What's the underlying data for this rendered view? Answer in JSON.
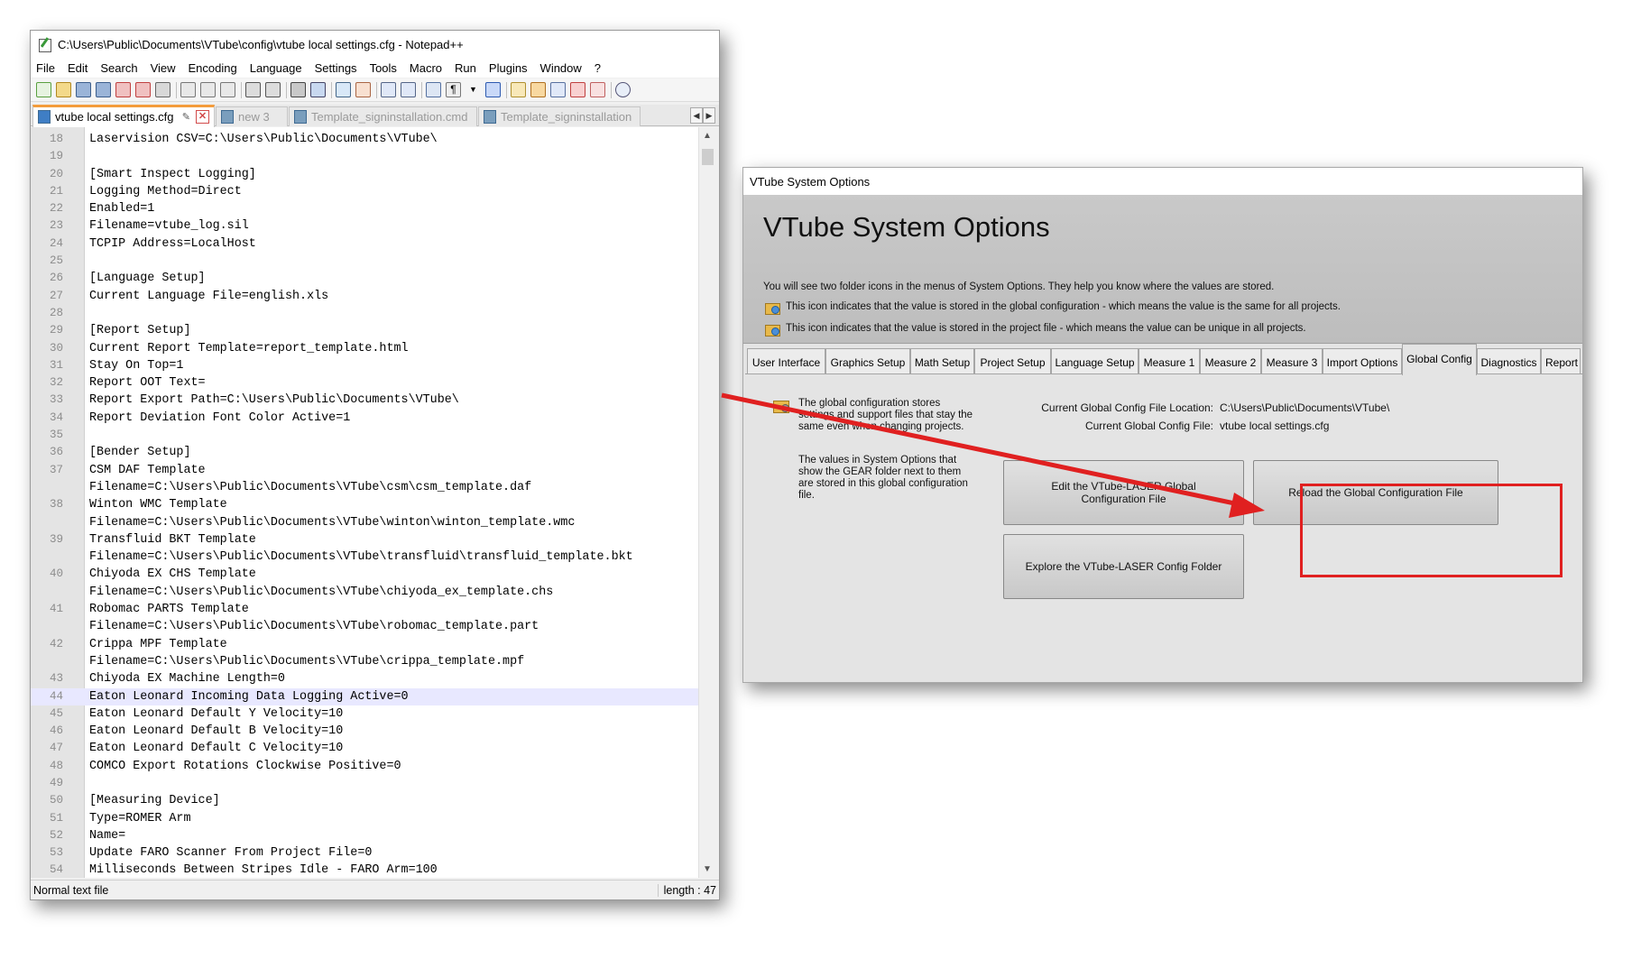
{
  "notepad": {
    "title": "C:\\Users\\Public\\Documents\\VTube\\config\\vtube local settings.cfg - Notepad++",
    "menu": [
      "File",
      "Edit",
      "Search",
      "View",
      "Encoding",
      "Language",
      "Settings",
      "Tools",
      "Macro",
      "Run",
      "Plugins",
      "Window",
      "?"
    ],
    "tabs": [
      "vtube local settings.cfg",
      "new 3",
      "Template_signinstallation.cmd",
      "Template_signinstallation"
    ],
    "tab_arrows": [
      "◀",
      "▶"
    ],
    "lines": [
      {
        "n": "18",
        "t": "Laservision CSV=C:\\Users\\Public\\Documents\\VTube\\"
      },
      {
        "n": "19",
        "t": ""
      },
      {
        "n": "20",
        "t": "[Smart Inspect Logging]"
      },
      {
        "n": "21",
        "t": "Logging Method=Direct"
      },
      {
        "n": "22",
        "t": "Enabled=1"
      },
      {
        "n": "23",
        "t": "Filename=vtube_log.sil"
      },
      {
        "n": "24",
        "t": "TCPIP Address=LocalHost"
      },
      {
        "n": "25",
        "t": ""
      },
      {
        "n": "26",
        "t": "[Language Setup]"
      },
      {
        "n": "27",
        "t": "Current Language File=english.xls"
      },
      {
        "n": "28",
        "t": ""
      },
      {
        "n": "29",
        "t": "[Report Setup]"
      },
      {
        "n": "30",
        "t": "Current Report Template=report_template.html"
      },
      {
        "n": "31",
        "t": "Stay On Top=1"
      },
      {
        "n": "32",
        "t": "Report OOT Text="
      },
      {
        "n": "33",
        "t": "Report Export Path=C:\\Users\\Public\\Documents\\VTube\\"
      },
      {
        "n": "34",
        "t": "Report Deviation Font Color Active=1"
      },
      {
        "n": "35",
        "t": ""
      },
      {
        "n": "36",
        "t": "[Bender Setup]"
      },
      {
        "n": "37",
        "t": "CSM DAF Template"
      },
      {
        "n": "",
        "t": "Filename=C:\\Users\\Public\\Documents\\VTube\\csm\\csm_template.daf"
      },
      {
        "n": "38",
        "t": "Winton WMC Template"
      },
      {
        "n": "",
        "t": "Filename=C:\\Users\\Public\\Documents\\VTube\\winton\\winton_template.wmc"
      },
      {
        "n": "39",
        "t": "Transfluid BKT Template"
      },
      {
        "n": "",
        "t": "Filename=C:\\Users\\Public\\Documents\\VTube\\transfluid\\transfluid_template.bkt"
      },
      {
        "n": "40",
        "t": "Chiyoda EX CHS Template"
      },
      {
        "n": "",
        "t": "Filename=C:\\Users\\Public\\Documents\\VTube\\chiyoda_ex_template.chs"
      },
      {
        "n": "41",
        "t": "Robomac PARTS Template"
      },
      {
        "n": "",
        "t": "Filename=C:\\Users\\Public\\Documents\\VTube\\robomac_template.part"
      },
      {
        "n": "42",
        "t": "Crippa MPF Template"
      },
      {
        "n": "",
        "t": "Filename=C:\\Users\\Public\\Documents\\VTube\\crippa_template.mpf"
      },
      {
        "n": "43",
        "t": "Chiyoda EX Machine Length=0"
      },
      {
        "n": "44",
        "t": "Eaton Leonard Incoming Data Logging Active=0"
      },
      {
        "n": "45",
        "t": "Eaton Leonard Default Y Velocity=10"
      },
      {
        "n": "46",
        "t": "Eaton Leonard Default B Velocity=10"
      },
      {
        "n": "47",
        "t": "Eaton Leonard Default C Velocity=10"
      },
      {
        "n": "48",
        "t": "COMCO Export Rotations Clockwise Positive=0"
      },
      {
        "n": "49",
        "t": ""
      },
      {
        "n": "50",
        "t": "[Measuring Device]"
      },
      {
        "n": "51",
        "t": "Type=ROMER Arm"
      },
      {
        "n": "52",
        "t": "Name="
      },
      {
        "n": "53",
        "t": "Update FARO Scanner From Project File=0"
      },
      {
        "n": "54",
        "t": "Milliseconds Between Stripes Idle - FARO Arm=100"
      }
    ],
    "current_line_index": 32,
    "status_left": "Normal text file",
    "status_right": "length : 47"
  },
  "vtube": {
    "window_title": "VTube System Options",
    "heading": "VTube System Options",
    "info_line_1": "You will see two folder icons in the menus of System Options.  They help you know where the values are stored.",
    "info_line_2": "This icon indicates that the value is stored in the global configuration - which means the value is the same for all projects.",
    "info_line_3": "This icon indicates that the value is stored in the project file - which means the value can be unique in all projects.",
    "tabs": [
      "User Interface",
      "Graphics Setup",
      "Math Setup",
      "Project Setup",
      "Language Setup",
      "Measure 1",
      "Measure 2",
      "Measure 3",
      "Import Options",
      "Global Config",
      "Diagnostics",
      "Report"
    ],
    "active_tab": "Global Config",
    "desc_1": "The global configuration stores settings and support files that stay the same even when changing projects.",
    "desc_2": "The values in System Options that show the GEAR folder next to them are stored in this global configuration file.",
    "location_label": "Current Global Config File Location:",
    "location_value": "C:\\Users\\Public\\Documents\\VTube\\",
    "file_label": "Current Global Config File:",
    "file_value": "vtube local settings.cfg",
    "btn_edit": "Edit the VTube-LASER Global Configuration File",
    "btn_reload": "Reload the Global Configuration File",
    "btn_explore": "Explore the VTube-LASER Config Folder"
  },
  "colors": {
    "annotation_red": "#e02020",
    "tab_accent": "#f39c3c"
  }
}
